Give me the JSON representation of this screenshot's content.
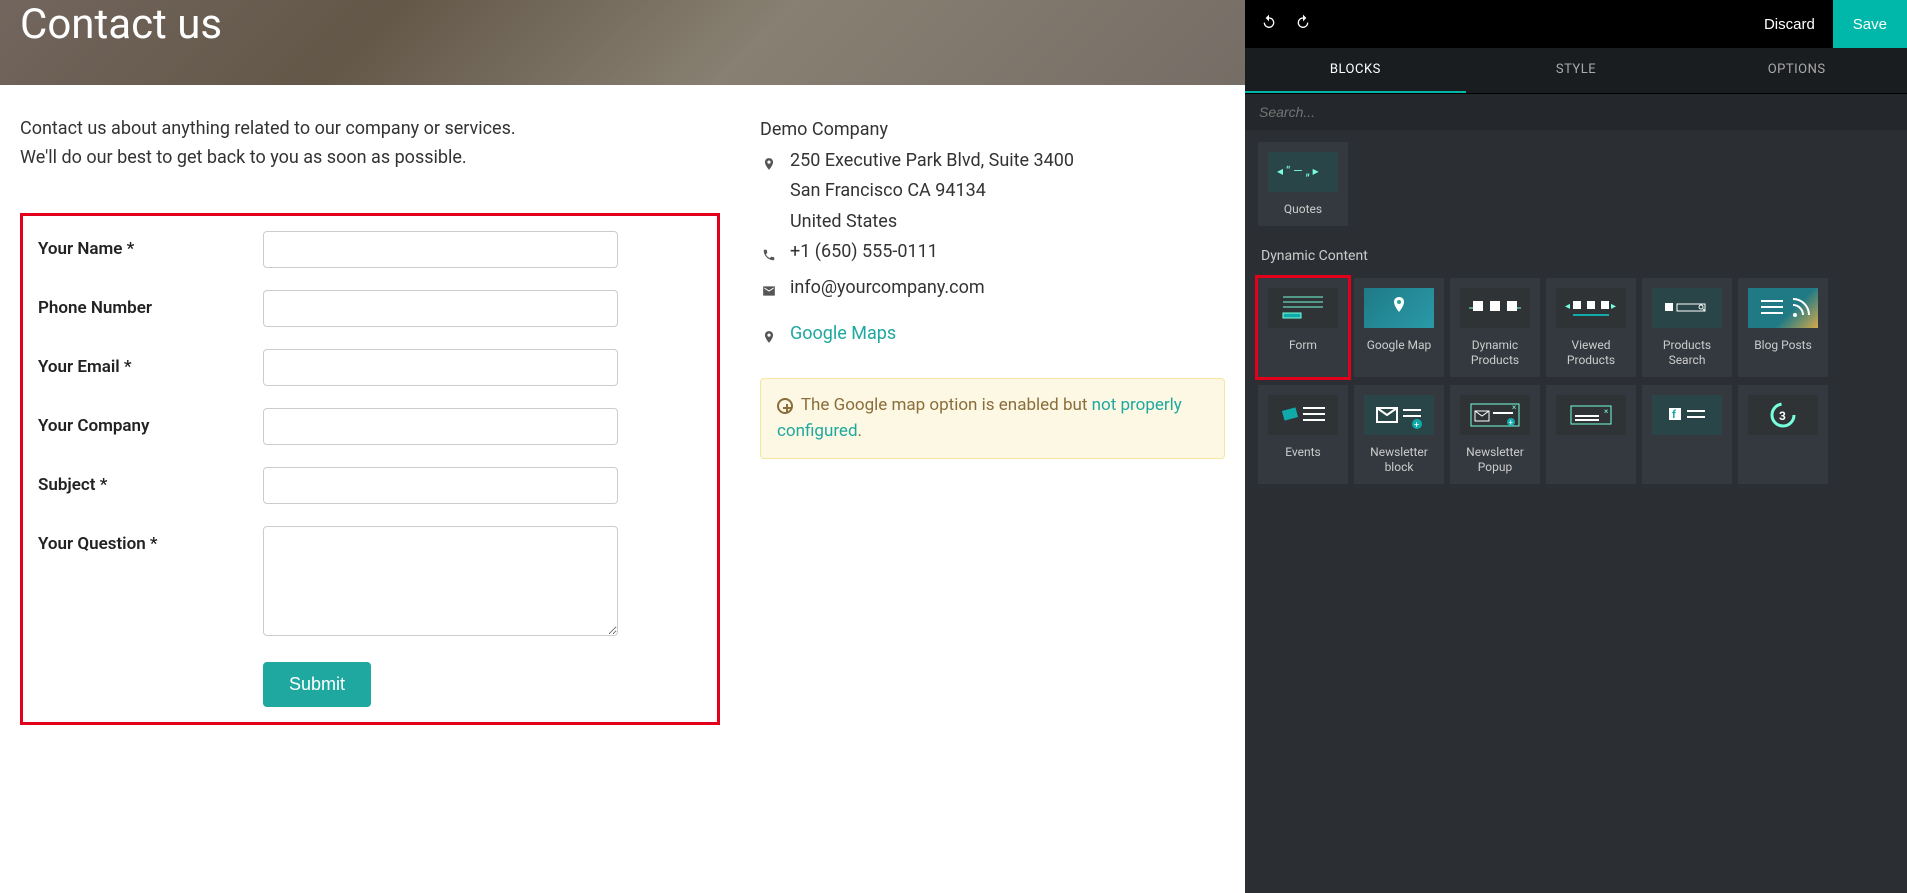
{
  "hero": {
    "title": "Contact us"
  },
  "intro": {
    "line1": "Contact us about anything related to our company or services.",
    "line2": "We'll do our best to get back to you as soon as possible."
  },
  "form": {
    "fields": {
      "name": "Your Name *",
      "phone": "Phone Number",
      "email": "Your Email *",
      "company": "Your Company",
      "subject": "Subject *",
      "question": "Your Question *"
    },
    "submit": "Submit"
  },
  "company": {
    "name": "Demo Company",
    "address_line1": "250 Executive Park Blvd, Suite 3400",
    "address_line2": "San Francisco CA 94134",
    "address_line3": "United States",
    "phone": "+1 (650) 555-0111",
    "email": "info@yourcompany.com",
    "maps_link": "Google Maps"
  },
  "alert": {
    "text_before": "The Google map option is enabled but ",
    "link": "not properly configured",
    "text_after": "."
  },
  "sidebar": {
    "discard": "Discard",
    "save": "Save",
    "tabs": {
      "blocks": "BLOCKS",
      "style": "STYLE",
      "options": "OPTIONS"
    },
    "search_placeholder": "Search...",
    "quotes_label": "Quotes",
    "section_dynamic": "Dynamic Content",
    "blocks": {
      "form": "Form",
      "google_map": "Google Map",
      "dynamic_products": "Dynamic Products",
      "viewed_products": "Viewed Products",
      "products_search": "Products Search",
      "blog_posts": "Blog Posts",
      "events": "Events",
      "newsletter_block": "Newsletter block",
      "newsletter_popup": "Newsletter Popup"
    }
  }
}
